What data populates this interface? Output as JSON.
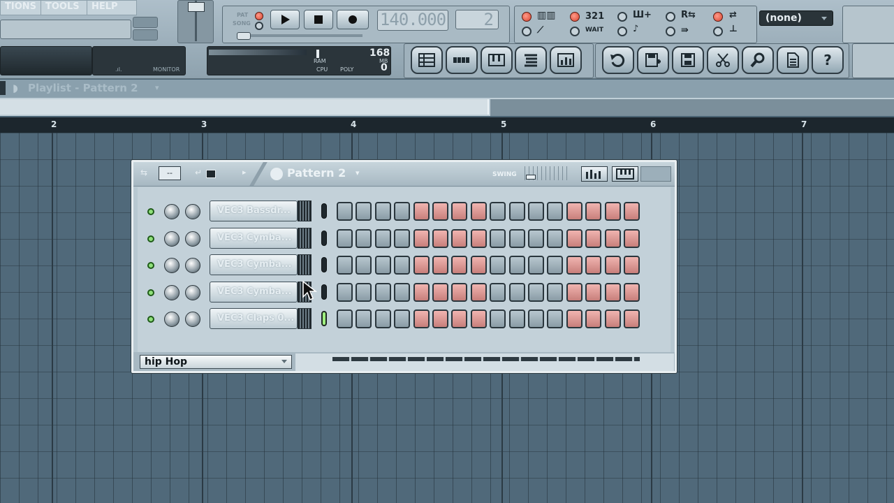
{
  "toolbar": {
    "menus": [
      "TIONS",
      "TOOLS",
      "HELP"
    ],
    "pat_song": [
      "PAT",
      "SONG"
    ],
    "tempo": "140.000",
    "pattern_number": "2",
    "snap_select": "(none)",
    "monitor_label": "MONITOR",
    "ram_label": "RAM",
    "ram_value": "168",
    "mb_label": "MB",
    "cpu_label": "CPU",
    "poly_label": "POLY",
    "poly_value": "0",
    "mode_labels": [
      "321",
      "WAIT"
    ],
    "tool_buttons": [
      "playlist",
      "step-sequencer",
      "piano-roll",
      "browser",
      "mixer",
      "undo",
      "save",
      "render",
      "cut",
      "zoom",
      "project-info",
      "help"
    ]
  },
  "playlist": {
    "title": "Playlist - Pattern 2",
    "bar_numbers": [
      "2",
      "3",
      "4",
      "5",
      "6",
      "7"
    ]
  },
  "sequencer": {
    "pattern_name": "Pattern 2",
    "swing_label": "SWING",
    "preset": "hip Hop",
    "channels": [
      {
        "name": "VEC3 Bassdr...",
        "selected": false
      },
      {
        "name": "VEC3 Cymba...",
        "selected": false
      },
      {
        "name": "VEC3 Cymba...",
        "selected": false
      },
      {
        "name": "VEC3 Cymba...",
        "selected": false
      },
      {
        "name": "VEC3 Claps 0...",
        "selected": true
      }
    ],
    "step_color_groups": [
      "gray",
      "gray",
      "gray",
      "gray",
      "red",
      "red",
      "red",
      "red",
      "gray",
      "gray",
      "gray",
      "gray",
      "red",
      "red",
      "red",
      "red"
    ],
    "colors": {
      "step_gray": "#9fb0b9",
      "step_red": "#e19a96",
      "channel_led": "#8fe07a"
    }
  }
}
